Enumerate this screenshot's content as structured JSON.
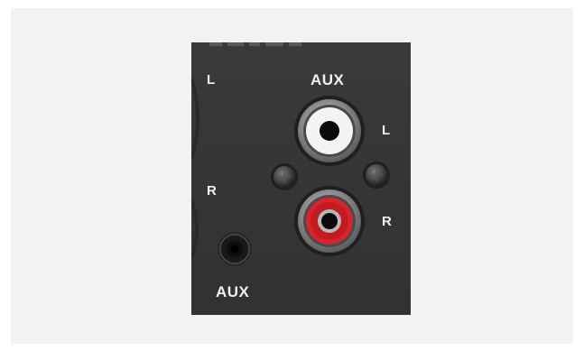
{
  "panel": {
    "left_section": {
      "label_left": "L",
      "label_right": "R",
      "jack_label": "AUX"
    },
    "rca_section": {
      "title": "AUX",
      "label_left": "L",
      "label_right": "R"
    },
    "colors": {
      "panel": "#363638",
      "rca_left_insulator": "#f4f4f4",
      "rca_right_insulator": "#d8232a",
      "metal_ring": "#8e8e90"
    }
  }
}
